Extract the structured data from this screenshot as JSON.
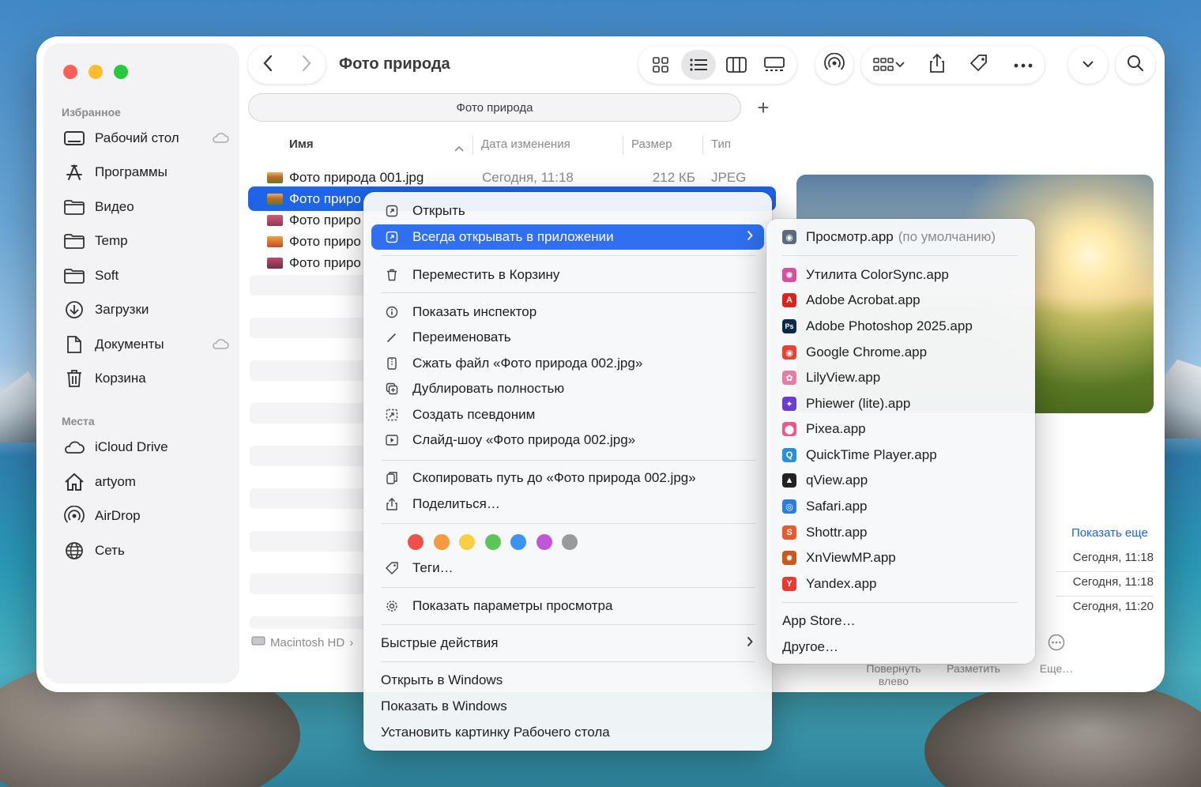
{
  "window": {
    "title": "Фото природа",
    "path_label": "Фото природа",
    "plus": "+"
  },
  "sidebar": {
    "favorites_title": "Избранное",
    "favorites": [
      {
        "label": "Рабочий стол",
        "icon": "desktop-icon",
        "cloud": true
      },
      {
        "label": "Программы",
        "icon": "applications-icon"
      },
      {
        "label": "Видео",
        "icon": "folder-icon"
      },
      {
        "label": "Temp",
        "icon": "folder-icon"
      },
      {
        "label": "Soft",
        "icon": "folder-icon"
      },
      {
        "label": "Загрузки",
        "icon": "downloads-icon"
      },
      {
        "label": "Документы",
        "icon": "document-icon",
        "cloud": true
      },
      {
        "label": "Корзина",
        "icon": "trash-icon"
      }
    ],
    "places_title": "Места",
    "places": [
      {
        "label": "iCloud Drive",
        "icon": "cloud-icon"
      },
      {
        "label": "artyom",
        "icon": "home-icon"
      },
      {
        "label": "AirDrop",
        "icon": "airdrop-icon"
      },
      {
        "label": "Сеть",
        "icon": "globe-icon"
      }
    ]
  },
  "columns": {
    "name": "Имя",
    "date": "Дата изменения",
    "size": "Размер",
    "type": "Тип"
  },
  "files": [
    {
      "name": "Фото природа 001.jpg",
      "date": "Сегодня, 11:18",
      "size": "212 КБ",
      "type": "JPEG"
    },
    {
      "name": "Фото приро",
      "selected": true
    },
    {
      "name": "Фото приро"
    },
    {
      "name": "Фото приро"
    },
    {
      "name": "Фото приро"
    }
  ],
  "statusbar": {
    "disk": "Macintosh HD",
    "sep": "›"
  },
  "context_menu": {
    "open": "Открыть",
    "always_open_with": "Всегда открывать в приложении",
    "move_to_trash": "Переместить в Корзину",
    "show_inspector": "Показать инспектор",
    "rename": "Переименовать",
    "compress": "Сжать файл «Фото природа 002.jpg»",
    "duplicate": "Дублировать полностью",
    "make_alias": "Создать псевдоним",
    "slideshow": "Слайд-шоу «Фото природа 002.jpg»",
    "copy_path": "Скопировать путь до «Фото природа 002.jpg»",
    "share": "Поделиться…",
    "tags": "Теги…",
    "view_options": "Показать параметры просмотра",
    "quick_actions": "Быстрые действия",
    "open_in_windows": "Открыть в Windows",
    "show_in_windows": "Показать в Windows",
    "set_wallpaper": "Установить картинку Рабочего стола",
    "tag_colors": [
      "#f0504c",
      "#f69a3e",
      "#f7cf45",
      "#5cc658",
      "#3d93ef",
      "#c057d8",
      "#9a9a9e"
    ]
  },
  "submenu": {
    "default_app": "Просмотр.app",
    "default_suffix": "(по умолчанию)",
    "apps": [
      {
        "label": "Утилита ColorSync.app",
        "color": "#d94fa0",
        "glyph": "✺"
      },
      {
        "label": "Adobe Acrobat.app",
        "color": "#d9231f",
        "glyph": "A"
      },
      {
        "label": "Adobe Photoshop 2025.app",
        "color": "#0b2a4a",
        "glyph": "Ps"
      },
      {
        "label": "Google Chrome.app",
        "color": "#e94235",
        "glyph": "◉"
      },
      {
        "label": "LilyView.app",
        "color": "#e27fa8",
        "glyph": "✿"
      },
      {
        "label": "Phiewer (lite).app",
        "color": "#6a3ccf",
        "glyph": "✦"
      },
      {
        "label": "Pixea.app",
        "color": "#e85a8a",
        "glyph": "⬤"
      },
      {
        "label": "QuickTime Player.app",
        "color": "#2a8fd8",
        "glyph": "Q"
      },
      {
        "label": "qView.app",
        "color": "#222222",
        "glyph": "▲"
      },
      {
        "label": "Safari.app",
        "color": "#2d7de0",
        "glyph": "◎"
      },
      {
        "label": "Shottr.app",
        "color": "#e55a2f",
        "glyph": "S"
      },
      {
        "label": "XnViewMP.app",
        "color": "#c85a1e",
        "glyph": "✸"
      },
      {
        "label": "Yandex.app",
        "color": "#e63b2e",
        "glyph": "Y"
      }
    ],
    "app_store": "App Store…",
    "other": "Другое…"
  },
  "preview": {
    "show_more": "Показать еще",
    "dates": [
      "Сегодня, 11:18",
      "Сегодня, 11:18",
      "Сегодня, 11:20"
    ],
    "actions": [
      {
        "label": "Повернуть влево"
      },
      {
        "label": "Разметить"
      },
      {
        "label": "Еще…"
      }
    ]
  }
}
